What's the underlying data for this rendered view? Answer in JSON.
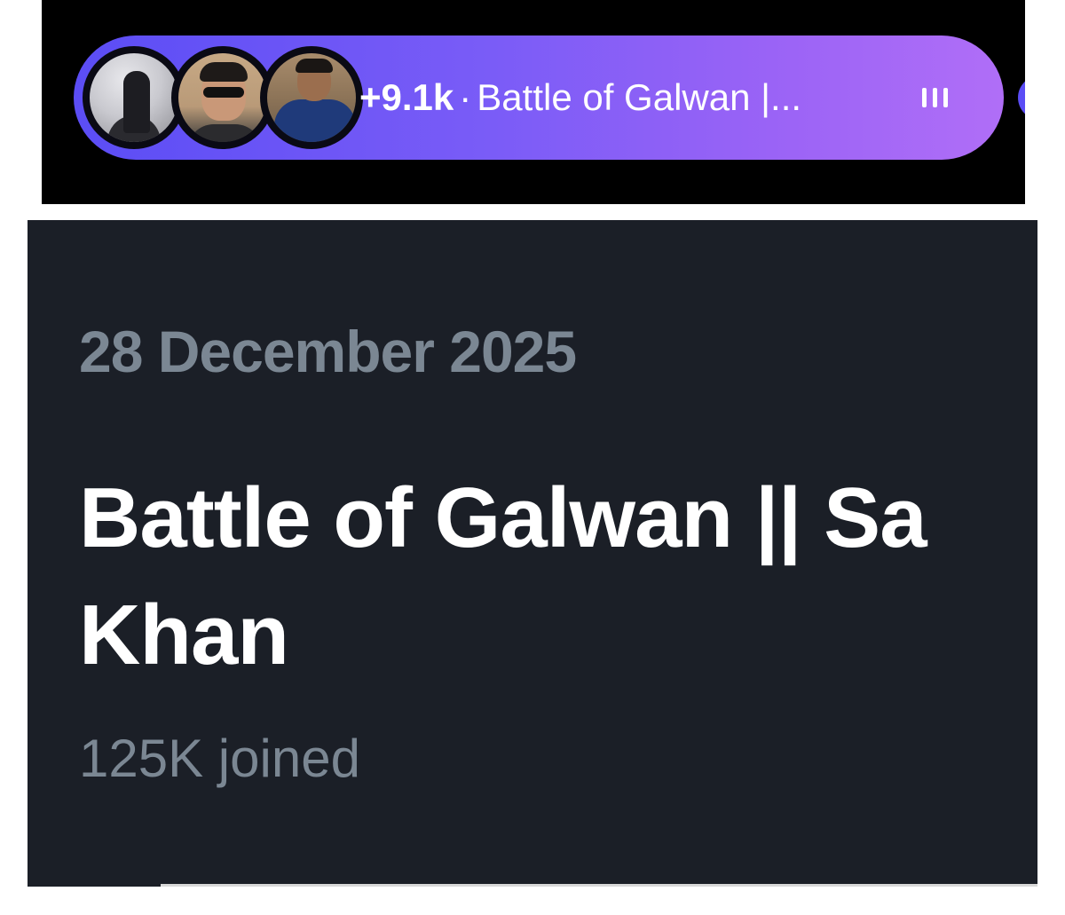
{
  "live_pill": {
    "count": "+9.1k",
    "separator": "·",
    "title": "Battle of Galwan |...",
    "icon": "audio-bars-icon",
    "accent_color": "#7a5cf7",
    "avatars": [
      "avatar-silhouette",
      "avatar-sunglasses",
      "avatar-suit"
    ]
  },
  "space_card": {
    "date": "28 December 2025",
    "title_line_1": "Battle of Galwan || Sa",
    "title_line_2": "Khan",
    "joined": "125K joined",
    "background_color": "#1b1f27",
    "muted_text_color": "#7b8793"
  }
}
